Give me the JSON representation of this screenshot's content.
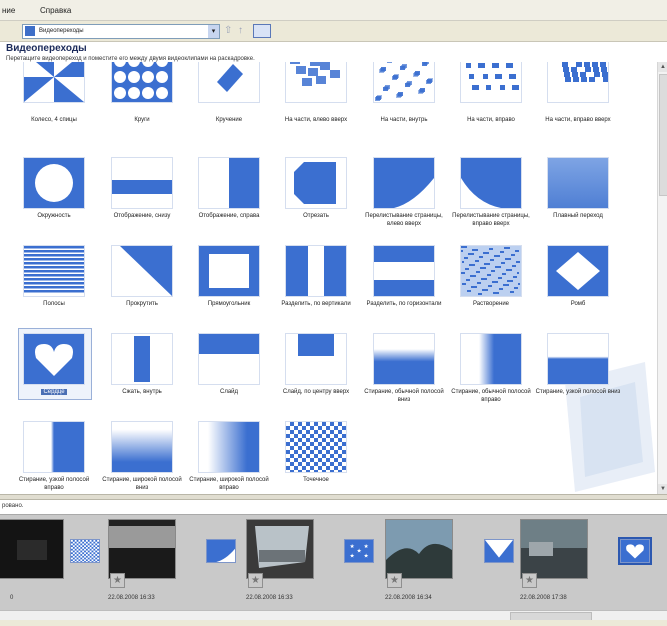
{
  "menu": {
    "left_fragment": "ние",
    "help": "Справка"
  },
  "toolbar": {
    "address_value": "Видеопереходы"
  },
  "header": {
    "title": "Видеопереходы",
    "subtitle": "Перетащите видеопереход и поместите его между двумя видеоклипами на раскадровке."
  },
  "tiles": [
    {
      "label": "Колесо, 4 спицы",
      "icon": "wheel-4-spokes"
    },
    {
      "label": "Круги",
      "icon": "circles"
    },
    {
      "label": "Кручение",
      "icon": "spin"
    },
    {
      "label": "На части, влево вверх",
      "icon": "shatter-up-left"
    },
    {
      "label": "На части, внутрь",
      "icon": "shatter-in"
    },
    {
      "label": "На части, вправо",
      "icon": "shatter-right"
    },
    {
      "label": "На части, вправо вверх",
      "icon": "shatter-up-right"
    },
    {
      "label": "Окружность",
      "icon": "circle"
    },
    {
      "label": "Отображение, снизу",
      "icon": "reveal-down"
    },
    {
      "label": "Отображение, справа",
      "icon": "reveal-right"
    },
    {
      "label": "Отрезать",
      "icon": "cut"
    },
    {
      "label": "Перелистывание страницы, влево вверх",
      "icon": "page-curl-up-left"
    },
    {
      "label": "Перелистывание страницы, вправо вверх",
      "icon": "page-curl-up-right"
    },
    {
      "label": "Плавный переход",
      "icon": "fade"
    },
    {
      "label": "Полосы",
      "icon": "bars"
    },
    {
      "label": "Прокрутить",
      "icon": "roll"
    },
    {
      "label": "Прямоугольник",
      "icon": "rectangle"
    },
    {
      "label": "Разделить, по вертикали",
      "icon": "split-vertical"
    },
    {
      "label": "Разделить, по горизонтали",
      "icon": "split-horizontal"
    },
    {
      "label": "Растворение",
      "icon": "dissolve"
    },
    {
      "label": "Ромб",
      "icon": "diamond"
    },
    {
      "label": "Сердце",
      "icon": "heart",
      "selected": true
    },
    {
      "label": "Сжать, внутрь",
      "icon": "squeeze-in"
    },
    {
      "label": "Слайд",
      "icon": "slide"
    },
    {
      "label": "Слайд, по центру вверх",
      "icon": "slide-up-center"
    },
    {
      "label": "Стирание, обычной полосой вниз",
      "icon": "wipe-normal-down"
    },
    {
      "label": "Стирание, обычной полосой вправо",
      "icon": "wipe-normal-right"
    },
    {
      "label": "Стирание, узкой полосой вниз",
      "icon": "wipe-narrow-down"
    },
    {
      "label": "Стирание, узкой полосой вправо",
      "icon": "wipe-narrow-right"
    },
    {
      "label": "Стирание, широкой полосой вниз",
      "icon": "wipe-wide-down"
    },
    {
      "label": "Стирание, широкой полосой вправо",
      "icon": "wipe-wide-right"
    },
    {
      "label": "Точечное",
      "icon": "checker"
    }
  ],
  "storyboard": {
    "hint": "ровано.",
    "clips": [
      {
        "date": "0",
        "scene": "dark"
      },
      {
        "date": "22.08.2008 16:33",
        "scene": "car-interior"
      },
      {
        "date": "22.08.2008 16:33",
        "scene": "road-window"
      },
      {
        "date": "22.08.2008 16:34",
        "scene": "trees-sky"
      },
      {
        "date": "22.08.2008 17:38",
        "scene": "parking"
      }
    ],
    "transitions": [
      "checker",
      "page-curl-up-left",
      "stars",
      "diamond-down",
      "heart"
    ]
  },
  "colors": {
    "accent": "#3b6fd0",
    "selection": "#4a6fb4",
    "menubar": "#f1efe6",
    "storyboard": "#c9c9c9"
  }
}
